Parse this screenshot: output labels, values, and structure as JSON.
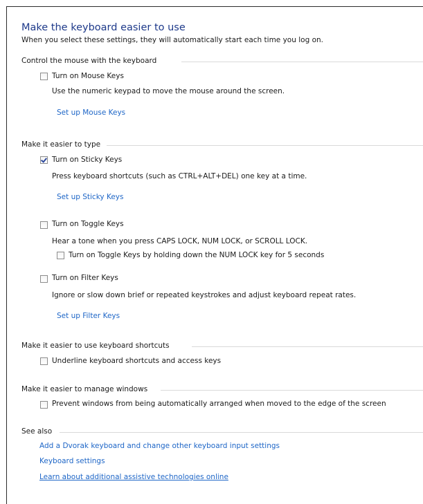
{
  "header": {
    "title": "Make the keyboard easier to use",
    "subtitle": "When you select these settings, they will automatically start each time you log on."
  },
  "sections": {
    "mouse": {
      "label": "Control the mouse with the keyboard",
      "mouse_keys": {
        "label": "Turn on Mouse Keys",
        "checked": false,
        "description": "Use the numeric keypad to move the mouse around the screen.",
        "setup_link": "Set up Mouse Keys"
      }
    },
    "typing": {
      "label": "Make it easier to type",
      "sticky_keys": {
        "label": "Turn on Sticky Keys",
        "checked": true,
        "description": "Press keyboard shortcuts (such as CTRL+ALT+DEL) one key at a time.",
        "setup_link": "Set up Sticky Keys"
      },
      "toggle_keys": {
        "label": "Turn on Toggle Keys",
        "checked": false,
        "description": "Hear a tone when you press CAPS LOCK, NUM LOCK, or SCROLL LOCK.",
        "sub_option_label": "Turn on Toggle Keys by holding down the NUM LOCK key for 5 seconds",
        "sub_option_checked": false
      },
      "filter_keys": {
        "label": "Turn on Filter Keys",
        "checked": false,
        "description": "Ignore or slow down brief or repeated keystrokes and adjust keyboard repeat rates.",
        "setup_link": "Set up Filter Keys"
      }
    },
    "shortcuts": {
      "label": "Make it easier to use keyboard shortcuts",
      "underline": {
        "label": "Underline keyboard shortcuts and access keys",
        "checked": false
      }
    },
    "windows": {
      "label": "Make it easier to manage windows",
      "prevent_arrange": {
        "label": "Prevent windows from being automatically arranged when moved to the edge of the screen",
        "checked": false
      }
    },
    "see_also": {
      "label": "See also",
      "links": [
        "Add a Dvorak keyboard and change other keyboard input settings",
        "Keyboard settings",
        "Learn about additional assistive technologies online"
      ]
    }
  },
  "colors": {
    "title": "#1e3a8a",
    "link": "#1e66c7",
    "group_line": "#d9d9d9"
  }
}
